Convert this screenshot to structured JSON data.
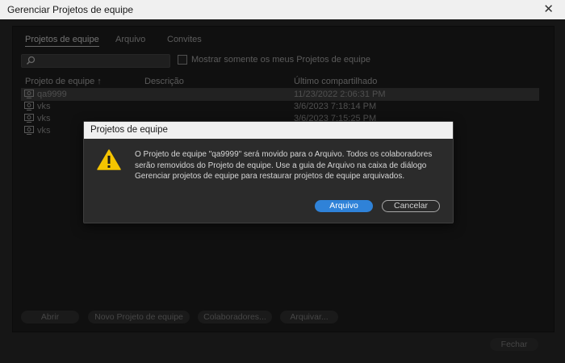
{
  "window": {
    "title": "Gerenciar Projetos de equipe"
  },
  "tabs": [
    {
      "label": "Projetos de equipe",
      "active": true
    },
    {
      "label": "Arquivo",
      "active": false
    },
    {
      "label": "Convites",
      "active": false
    }
  ],
  "search": {
    "placeholder": ""
  },
  "filter": {
    "label": "Mostrar somente os meus Projetos de equipe",
    "checked": false
  },
  "table": {
    "headers": {
      "name": "Projeto de equipe",
      "sort_indicator": "↑",
      "description": "Descrição",
      "last_shared": "Último compartilhado"
    },
    "rows": [
      {
        "name": "qa9999",
        "description": "",
        "last_shared": "11/23/2022 2:06:31 PM",
        "selected": true
      },
      {
        "name": "vks",
        "description": "",
        "last_shared": "3/6/2023 7:18:14 PM",
        "selected": false
      },
      {
        "name": "vks",
        "description": "",
        "last_shared": "3/6/2023 7:15:25 PM",
        "selected": false
      },
      {
        "name": "vks",
        "description": "",
        "last_shared": "",
        "selected": false
      }
    ]
  },
  "bottom_buttons": {
    "open": "Abrir",
    "new_project": "Novo Projeto de equipe",
    "collaborators": "Colaboradores...",
    "archive": "Arquivar..."
  },
  "close_label": "Fechar",
  "dialog": {
    "title": "Projetos de equipe",
    "message": "O Projeto de equipe \"qa9999\" será movido para o Arquivo. Todos os colaboradores serão removidos do Projeto de equipe. Use a guia de Arquivo na caixa de diálogo Gerenciar projetos de equipe para restaurar projetos de equipe arquivados.",
    "confirm_label": "Arquivo",
    "cancel_label": "Cancelar",
    "icon": "warning-icon"
  },
  "colors": {
    "accent": "#2f82d8",
    "warning": "#f5c400"
  }
}
